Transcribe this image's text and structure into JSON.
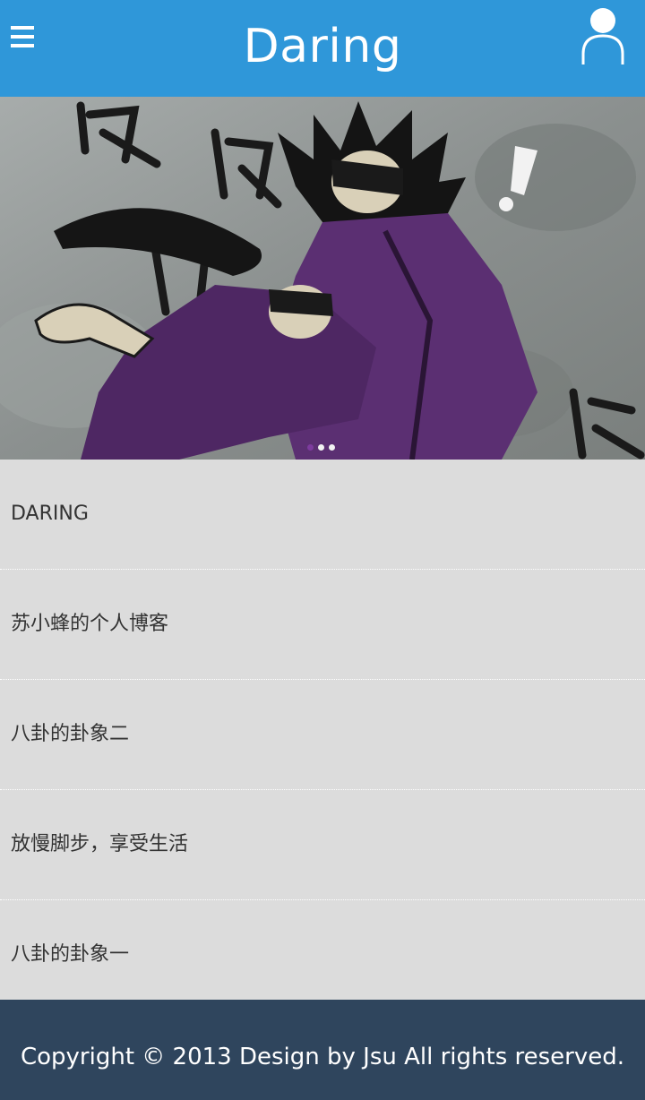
{
  "header": {
    "title": "Daring",
    "menu_icon": "hamburger-menu-icon",
    "user_icon": "user-profile-icon",
    "background_color": "#2f97d9"
  },
  "carousel": {
    "image_description": "illustrated comic banner",
    "slides_count": 3,
    "active_slide": 1
  },
  "list": {
    "items": [
      {
        "label": "DARING"
      },
      {
        "label": "苏小蜂的个人博客"
      },
      {
        "label": "八卦的卦象二"
      },
      {
        "label": "放慢脚步，享受生活"
      },
      {
        "label": "八卦的卦象一"
      }
    ]
  },
  "footer": {
    "text": "Copyright © 2013 Design by Jsu All rights reserved.",
    "background_color": "#2f455d"
  }
}
